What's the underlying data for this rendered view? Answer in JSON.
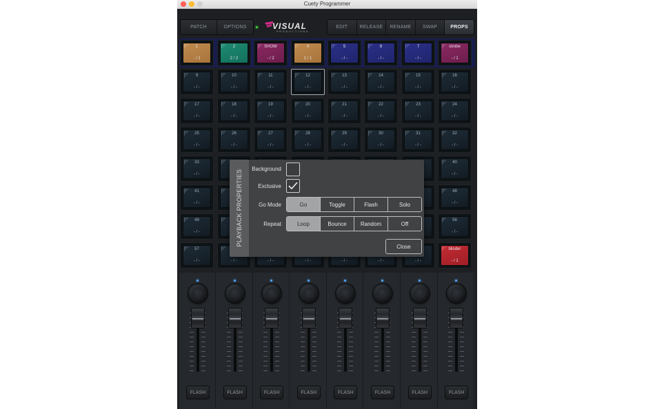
{
  "window": {
    "title": "Cuety Programmer",
    "traffic_lights": [
      {
        "name": "close",
        "color": "#fe5f57"
      },
      {
        "name": "minimize",
        "color": "#febc2e"
      },
      {
        "name": "zoom",
        "color": "#d0d0d0"
      }
    ]
  },
  "toolbar": {
    "left_buttons": [
      "PATCH",
      "OPTIONS"
    ],
    "right_buttons": [
      "EDIT",
      "RELEASE",
      "RENAME",
      "SWAP",
      "PROPS"
    ],
    "active_button": "PROPS"
  },
  "logo": {
    "text": "VISUAL",
    "subtext": "PRODUCTIONS",
    "icon": "visual-logo-mark"
  },
  "playback_grid": [
    [
      {
        "name": "1",
        "count": "- / 1",
        "color": "orange"
      },
      {
        "name": "2",
        "count": "2 / 2",
        "color": "green"
      },
      {
        "name": "SHOW",
        "count": "- / 2",
        "color": "magenta"
      },
      {
        "name": "4",
        "count": "1 / 1",
        "color": "orange"
      },
      {
        "name": "5",
        "count": "- / -",
        "color": "blue"
      },
      {
        "name": "6",
        "count": "- / -",
        "color": "blue"
      },
      {
        "name": "7",
        "count": "- / -",
        "color": "blue"
      },
      {
        "name": "strobe",
        "count": "- / 1",
        "color": "magenta"
      }
    ],
    [
      {
        "name": "9",
        "count": "- / -"
      },
      {
        "name": "10",
        "count": "- / -"
      },
      {
        "name": "11",
        "count": "- / -"
      },
      {
        "name": "12",
        "count": "- / -",
        "selected": true
      },
      {
        "name": "13",
        "count": "- / -"
      },
      {
        "name": "14",
        "count": "- / -"
      },
      {
        "name": "15",
        "count": "- / -"
      },
      {
        "name": "16",
        "count": "- / -"
      }
    ],
    [
      {
        "name": "17",
        "count": "- / -"
      },
      {
        "name": "18",
        "count": "- / -"
      },
      {
        "name": "19",
        "count": "- / -"
      },
      {
        "name": "20",
        "count": "- / -"
      },
      {
        "name": "21",
        "count": "- / -"
      },
      {
        "name": "22",
        "count": "- / -"
      },
      {
        "name": "23",
        "count": "- / -"
      },
      {
        "name": "24",
        "count": "- / -"
      }
    ],
    [
      {
        "name": "25",
        "count": "- / -"
      },
      {
        "name": "26",
        "count": "- / -"
      },
      {
        "name": "27",
        "count": "- / -"
      },
      {
        "name": "28",
        "count": "- / -"
      },
      {
        "name": "29",
        "count": "- / -"
      },
      {
        "name": "30",
        "count": "- / -"
      },
      {
        "name": "31",
        "count": "- / -"
      },
      {
        "name": "32",
        "count": "- / -"
      }
    ],
    [
      {
        "name": "33",
        "count": "- / -"
      },
      {
        "name": "",
        "count": ""
      },
      {
        "name": "",
        "count": ""
      },
      {
        "name": "",
        "count": ""
      },
      {
        "name": "",
        "count": ""
      },
      {
        "name": "",
        "count": ""
      },
      {
        "name": "",
        "count": ""
      },
      {
        "name": "40",
        "count": "- / -"
      }
    ],
    [
      {
        "name": "41",
        "count": "- / -"
      },
      {
        "name": "",
        "count": ""
      },
      {
        "name": "",
        "count": ""
      },
      {
        "name": "",
        "count": ""
      },
      {
        "name": "",
        "count": ""
      },
      {
        "name": "",
        "count": ""
      },
      {
        "name": "",
        "count": ""
      },
      {
        "name": "48",
        "count": "- / -"
      }
    ],
    [
      {
        "name": "49",
        "count": "- / -"
      },
      {
        "name": "",
        "count": ""
      },
      {
        "name": "",
        "count": ""
      },
      {
        "name": "",
        "count": ""
      },
      {
        "name": "",
        "count": ""
      },
      {
        "name": "",
        "count": ""
      },
      {
        "name": "",
        "count": ""
      },
      {
        "name": "56",
        "count": "- / -"
      }
    ],
    [
      {
        "name": "57",
        "count": "- / -"
      },
      {
        "name": "",
        "count": "- / -"
      },
      {
        "name": "",
        "count": "- / -"
      },
      {
        "name": "",
        "count": "- / -"
      },
      {
        "name": "",
        "count": "- / -"
      },
      {
        "name": "",
        "count": "- / -"
      },
      {
        "name": "",
        "count": "- / -"
      },
      {
        "name": "blinder",
        "count": "- / 1",
        "color": "red"
      }
    ]
  ],
  "faders": {
    "count": 8,
    "flash_label": "FLASH",
    "levels": [
      1,
      1,
      1,
      1,
      1,
      1,
      1,
      1
    ]
  },
  "dialog": {
    "title": "PLAYBACK PROPERTIES",
    "background_label": "Background",
    "background_checked": false,
    "exclusive_label": "Exclusive",
    "exclusive_checked": true,
    "go_mode_label": "Go Mode",
    "go_mode_options": [
      "Go",
      "Toggle",
      "Flash",
      "Solo"
    ],
    "go_mode_selected": "Go",
    "repeat_label": "Repeat",
    "repeat_options": [
      "Loop",
      "Bounce",
      "Random",
      "Off"
    ],
    "repeat_selected": "Loop",
    "close_label": "Close"
  },
  "colors": {
    "orange": "#c08a4e",
    "green": "#1f8a72",
    "magenta": "#8a2a62",
    "blue": "#2a2f86",
    "red": "#c22b33",
    "accent_led": "#3ddc3d",
    "knob_indicator": "#51a6ff"
  }
}
